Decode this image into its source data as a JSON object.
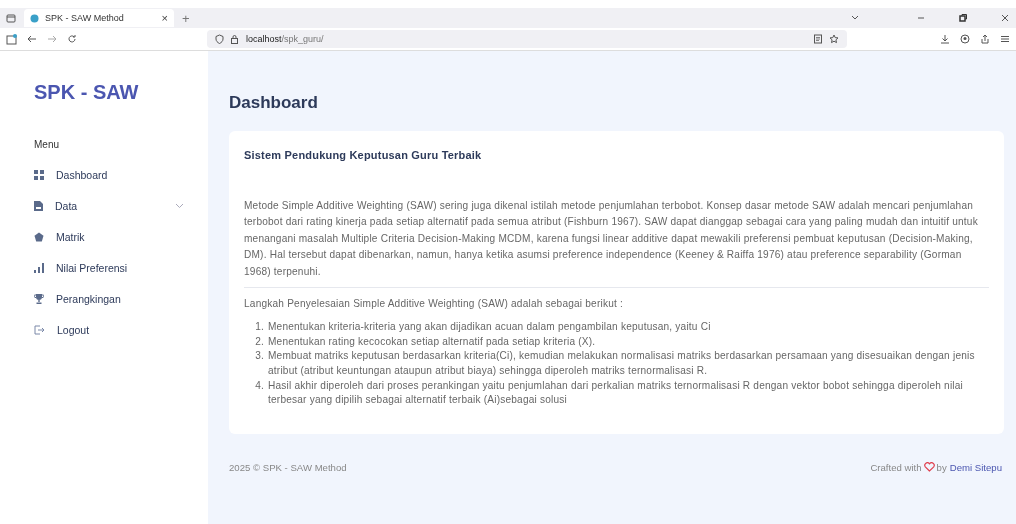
{
  "browser": {
    "tab": {
      "title": "SPK - SAW Method",
      "close": "×"
    },
    "new_tab": "+",
    "url": {
      "host": "localhost",
      "path": "/spk_guru/"
    }
  },
  "sidebar": {
    "brand": "SPK - SAW",
    "section": "Menu",
    "items": [
      {
        "label": "Dashboard",
        "has_submenu": false
      },
      {
        "label": "Data",
        "has_submenu": true
      },
      {
        "label": "Matrik",
        "has_submenu": false
      },
      {
        "label": "Nilai Preferensi",
        "has_submenu": false
      },
      {
        "label": "Perangkingan",
        "has_submenu": false
      },
      {
        "label": "Logout",
        "has_submenu": false
      }
    ]
  },
  "page_title": "Dashboard",
  "card": {
    "title": "Sistem Pendukung Keputusan Guru Terbaik",
    "intro": "Metode Simple Additive Weighting (SAW) sering juga dikenal istilah metode penjumlahan terbobot. Konsep dasar metode SAW adalah mencari penjumlahan terbobot dari rating kinerja pada setiap alternatif pada semua atribut (Fishburn 1967). SAW dapat dianggap sebagai cara yang paling mudah dan intuitif untuk menangani masalah Multiple Criteria Decision-Making MCDM, karena fungsi linear additive dapat mewakili preferensi pembuat keputusan (Decision-Making, DM). Hal tersebut dapat dibenarkan, namun, hanya ketika asumsi preference independence (Keeney & Raiffa 1976) atau preference separability (Gorman 1968) terpenuhi.",
    "steps_heading": "Langkah Penyelesaian Simple Additive Weighting (SAW) adalah sebagai berikut :",
    "steps": [
      {
        "number": "1.",
        "text": "Menentukan kriteria-kriteria yang akan dijadikan acuan dalam pengambilan keputusan, yaitu Ci"
      },
      {
        "number": "2.",
        "text": "Menentukan rating kecocokan setiap alternatif pada setiap kriteria (X)."
      },
      {
        "number": "3.",
        "text": "Membuat matriks keputusan berdasarkan kriteria(Ci), kemudian melakukan normalisasi matriks berdasarkan persamaan yang disesuaikan dengan jenis atribut (atribut keuntungan ataupun atribut biaya) sehingga diperoleh matriks ternormalisasi R."
      },
      {
        "number": "4.",
        "text": "Hasil akhir diperoleh dari proses perankingan yaitu penjumlahan dari perkalian matriks ternormalisasi R dengan vektor bobot sehingga diperoleh nilai terbesar yang dipilih sebagai alternatif terbaik (Ai)sebagai solusi"
      }
    ]
  },
  "footer": {
    "copyright": "2025 © SPK - SAW Method",
    "crafted": "Crafted with",
    "by": "by",
    "author": "Demi Sitepu"
  }
}
